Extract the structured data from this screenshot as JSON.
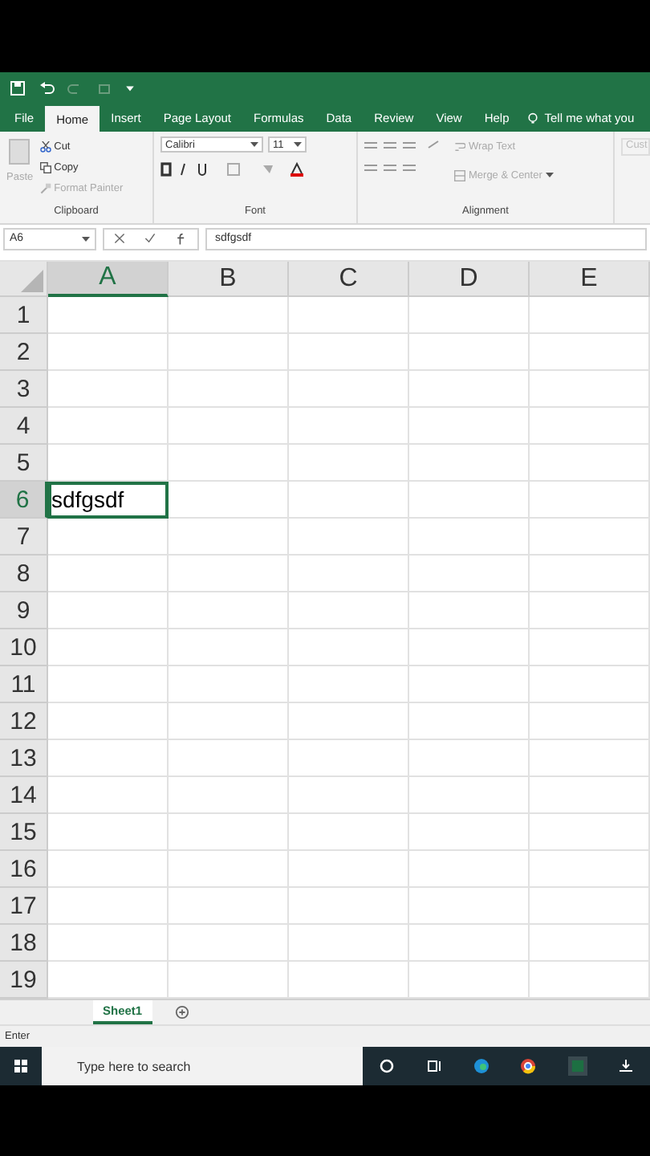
{
  "ribbon_tabs": [
    {
      "label": "File",
      "selected": false
    },
    {
      "label": "Home",
      "selected": true
    },
    {
      "label": "Insert",
      "selected": false
    },
    {
      "label": "Page Layout",
      "selected": false
    },
    {
      "label": "Formulas",
      "selected": false
    },
    {
      "label": "Data",
      "selected": false
    },
    {
      "label": "Review",
      "selected": false
    },
    {
      "label": "View",
      "selected": false
    },
    {
      "label": "Help",
      "selected": false
    }
  ],
  "tell_me": "Tell me what you",
  "clipboard": {
    "paste": "Paste",
    "cut": "Cut",
    "copy": "Copy",
    "format_painter": "Format Painter",
    "label": "Clipboard"
  },
  "font": {
    "name": "Calibri",
    "size": "11",
    "label": "Font"
  },
  "alignment": {
    "wrap_text": "Wrap Text",
    "merge_center": "Merge & Center",
    "label": "Alignment"
  },
  "number_format": "Cust",
  "name_box": "A6",
  "formula": "sdfgsdf",
  "columns": [
    {
      "label": "A",
      "selected": true
    },
    {
      "label": "B",
      "selected": false
    },
    {
      "label": "C",
      "selected": false
    },
    {
      "label": "D",
      "selected": false
    },
    {
      "label": "E",
      "selected": false
    }
  ],
  "rows": [
    {
      "label": "1",
      "selected": false,
      "cells": []
    },
    {
      "label": "2",
      "selected": false,
      "cells": []
    },
    {
      "label": "3",
      "selected": false,
      "cells": []
    },
    {
      "label": "4",
      "selected": false,
      "cells": []
    },
    {
      "label": "5",
      "selected": false,
      "cells": []
    },
    {
      "label": "6",
      "selected": true,
      "cells": [
        {
          "text": "sdfgsdf",
          "selected": true
        }
      ]
    },
    {
      "label": "7",
      "selected": false,
      "cells": []
    },
    {
      "label": "8",
      "selected": false,
      "cells": []
    },
    {
      "label": "9",
      "selected": false,
      "cells": []
    },
    {
      "label": "10",
      "selected": false,
      "cells": []
    },
    {
      "label": "11",
      "selected": false,
      "cells": []
    },
    {
      "label": "12",
      "selected": false,
      "cells": []
    },
    {
      "label": "13",
      "selected": false,
      "cells": []
    },
    {
      "label": "14",
      "selected": false,
      "cells": []
    },
    {
      "label": "15",
      "selected": false,
      "cells": []
    },
    {
      "label": "16",
      "selected": false,
      "cells": []
    },
    {
      "label": "17",
      "selected": false,
      "cells": []
    },
    {
      "label": "18",
      "selected": false,
      "cells": []
    },
    {
      "label": "19",
      "selected": false,
      "cells": []
    }
  ],
  "sheet_tabs": [
    {
      "label": "Sheet1",
      "selected": true
    }
  ],
  "status": "Enter",
  "taskbar": {
    "search_placeholder": "Type here to search"
  }
}
